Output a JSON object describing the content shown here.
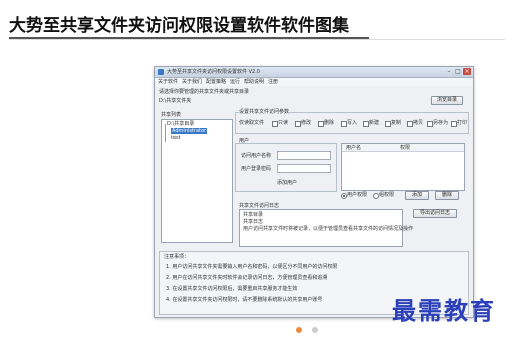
{
  "page": {
    "title": "大势至共享文件夹访问权限设置软件软件图集",
    "watermark": "最需教育",
    "carousel": {
      "active_index": 0,
      "count": 2,
      "active_color": "#f08a3c",
      "inactive_color": "#cccccc"
    }
  },
  "screenshot": {
    "window_title": "大势至共享文件夹访问权限设置软件 V2.0",
    "menu": [
      "关于软件",
      "关于我们",
      "配置策略",
      "运行",
      "帮助说明",
      "注册"
    ],
    "top_hint": "请选择你要管理的共享文件夹或共享目录",
    "share_label": "D:\\共享文件夹",
    "browse_button": "浏览目录",
    "left_panel": {
      "title": "共享列表",
      "tree": [
        "D:\\共享目录",
        "Administrator",
        "test"
      ]
    },
    "permissions": {
      "title": "设置共享文件访问参数",
      "items": [
        "仅读取文件",
        "只读",
        "修改",
        "删除",
        "写入",
        "新建",
        "复制",
        "拷贝",
        "另存为",
        "打印"
      ]
    },
    "user_section": {
      "title": "用户",
      "fields": [
        {
          "label": "访问用户名称",
          "value": ""
        },
        {
          "label": "用户登录密码",
          "value": ""
        }
      ],
      "add_button": "添加用户"
    },
    "user_list": {
      "columns": [
        "用户名",
        "权限"
      ]
    },
    "radios": {
      "options": [
        "用户权限",
        "组权限"
      ],
      "selected": 0
    },
    "action_buttons": [
      "添加",
      "删除"
    ],
    "log_section": {
      "title": "共享文件访问日志",
      "lines": [
        "共享目录",
        "共享日志",
        "用户访问共享文件时将被记录，以便于管理员查看共享文件的访问情况及操作"
      ],
      "export_button": "导出访问日志"
    },
    "notes": {
      "title": "注意事项：",
      "lines": [
        "1. 用户访问共享文件夹需要输入用户名和密码，以便区分不同用户的访问权限",
        "2. 用户在访问共享文件夹时软件会记录访问日志，方便管理员查看和追溯",
        "3. 在设置共享文件访问权限后，需要重启共享服务才能生效",
        "4. 在设置共享文件夹访问权限时，请不要删除系统默认的共享用户账号"
      ]
    }
  }
}
